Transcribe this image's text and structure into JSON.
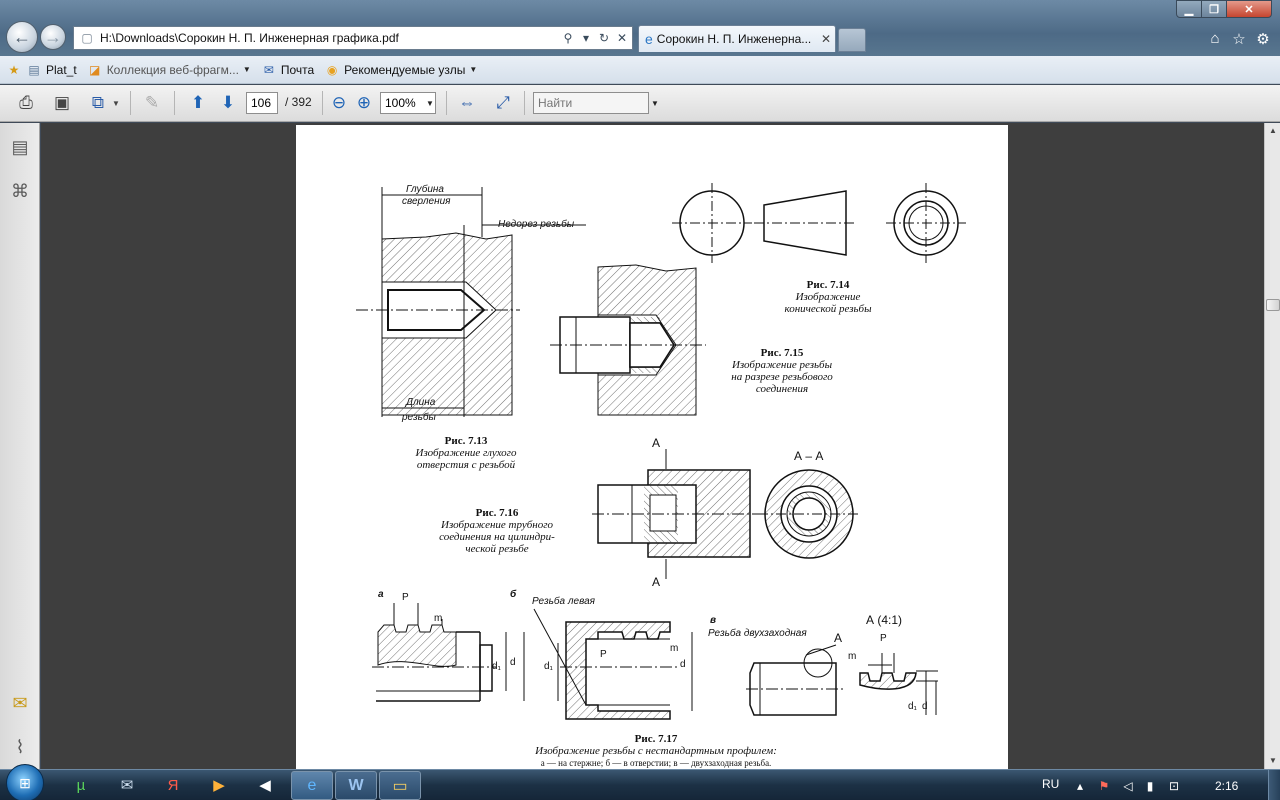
{
  "browser": {
    "address": "H:\\Downloads\\Сорокин Н. П. Инженерная графика.pdf",
    "tab_title": "Сорокин Н. П. Инженерна...",
    "favorites": [
      {
        "label": "Plat_t",
        "icon": "star-plus-icon"
      },
      {
        "label": "Коллекция веб-фрагм...",
        "icon": "web-slice-icon",
        "dropdown": true
      },
      {
        "label": "Почта",
        "icon": "mail-icon"
      },
      {
        "label": "Рекомендуемые узлы",
        "icon": "suggested-sites-icon",
        "dropdown": true
      }
    ]
  },
  "pdf_toolbar": {
    "page_current": "106",
    "page_total": "/ 392",
    "zoom": "100%",
    "find_placeholder": "Найти"
  },
  "document": {
    "figures": {
      "fig_7_13": {
        "number": "Рис. 7.13",
        "caption_1": "Изображение глухого",
        "caption_2": "отверстия с резьбой",
        "label_depth_1": "Глубина",
        "label_depth_2": "сверления",
        "label_undercut": "Недорез резьбы",
        "label_length_1": "Длина",
        "label_length_2": "резьбы"
      },
      "fig_7_14": {
        "number": "Рис. 7.14",
        "caption_1": "Изображение",
        "caption_2": "конической резьбы"
      },
      "fig_7_15": {
        "number": "Рис. 7.15",
        "caption_1": "Изображение резьбы",
        "caption_2": "на разрезе резьбового",
        "caption_3": "соединения"
      },
      "fig_7_16": {
        "number": "Рис. 7.16",
        "caption_1": "Изображение трубного",
        "caption_2": "соединения на цилиндри-",
        "caption_3": "ческой резьбе",
        "label_section": "А – А",
        "label_a": "А"
      },
      "fig_7_17": {
        "number": "Рис. 7.17",
        "caption_1": "Изображение резьбы с нестандартным профилем:",
        "caption_2": "а — на стержне; б — в отверстии; в — двухзаходная резьба.",
        "label_a": "а",
        "label_b": "б",
        "label_v": "в",
        "label_left": "Резьба левая",
        "label_double": "Резьба двухзаходная",
        "label_detail": "А (4:1)",
        "label_detail_mark": "А",
        "label_p": "P",
        "label_m": "m",
        "label_d": "d",
        "label_d1": "d₁"
      }
    }
  },
  "taskbar": {
    "language": "RU",
    "clock": "2:16"
  },
  "colors": {
    "doc_background": "#3e3e3e",
    "page": "#ffffff",
    "taskbar": "#1c3145",
    "titlebar": "#4d6a86"
  }
}
